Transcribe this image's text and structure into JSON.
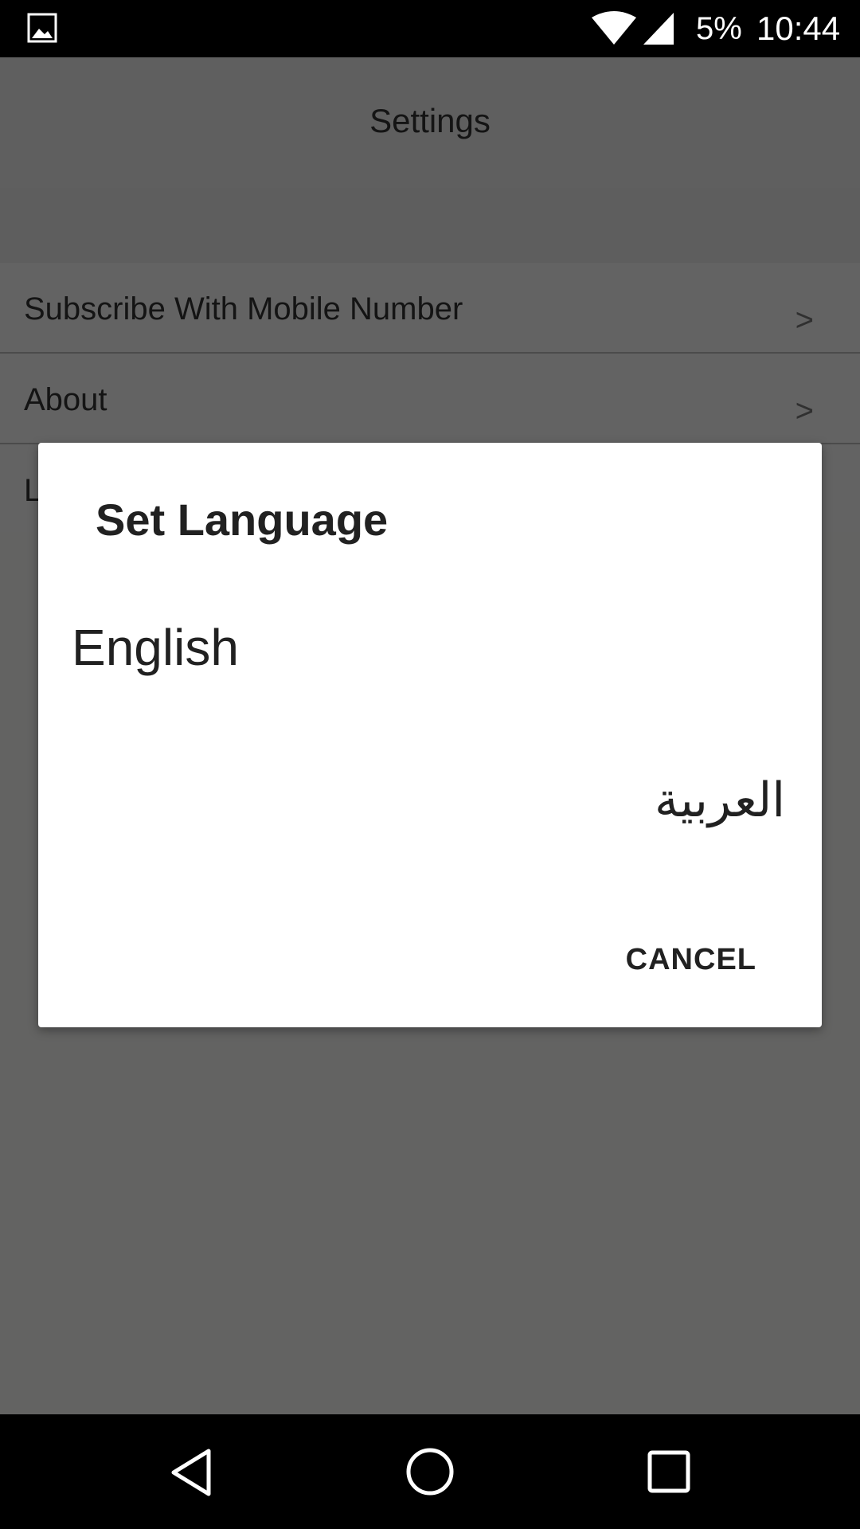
{
  "status_bar": {
    "battery": "5%",
    "time": "10:44",
    "icons": [
      "gallery-icon",
      "wifi-icon",
      "signal-icon"
    ]
  },
  "app_bar": {
    "title": "Settings"
  },
  "settings": {
    "items": [
      {
        "label": "Subscribe With Mobile Number",
        "chevron": ">"
      },
      {
        "label": "About",
        "chevron": ">"
      },
      {
        "label": "L"
      }
    ]
  },
  "dialog": {
    "title": "Set Language",
    "options": [
      {
        "label": "English"
      },
      {
        "label": "العربية"
      }
    ],
    "cancel_label": "CANCEL"
  },
  "nav_bar": {
    "icons": [
      "back-icon",
      "home-icon",
      "recent-apps-icon"
    ]
  },
  "colors": {
    "scrim": "#636362",
    "dialog_bg": "#ffffff",
    "text_dark": "#212121",
    "bars": "#000000"
  }
}
